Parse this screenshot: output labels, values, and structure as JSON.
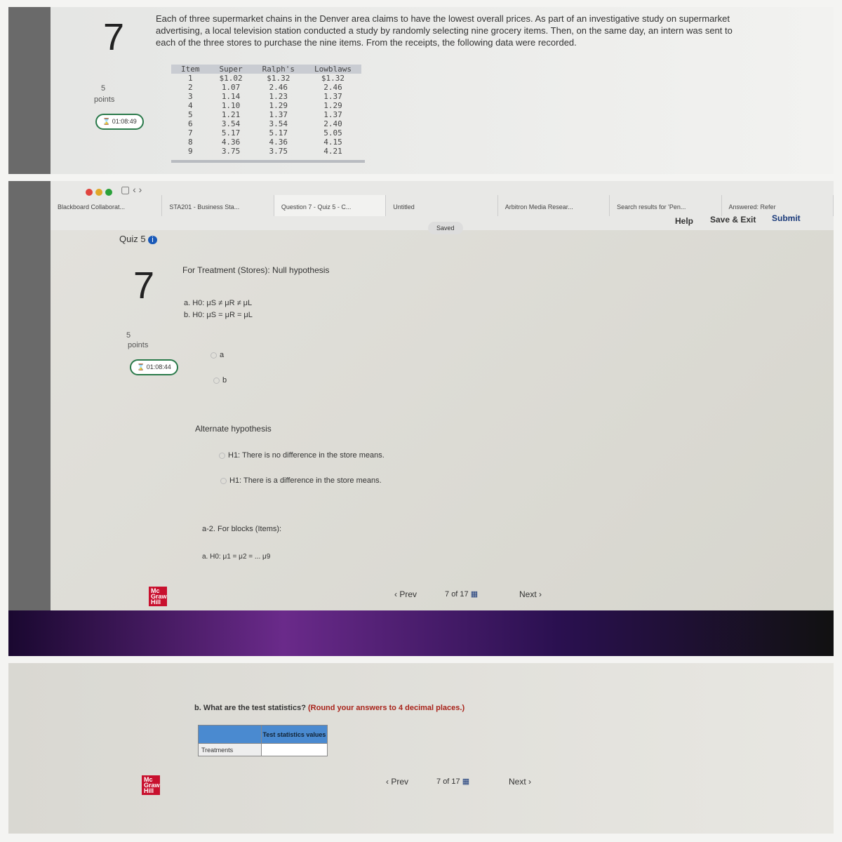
{
  "top": {
    "question_number": "7",
    "points_value": "5",
    "points_label": "points",
    "timer": "01:08:49",
    "intro": "Each of three supermarket chains in the Denver area claims to have the lowest overall prices. As part of an investigative study on supermarket advertising, a local television station conducted a study by randomly selecting nine grocery items. Then, on the same day, an intern was sent to each of the three stores to purchase the nine items. From the receipts, the following data were recorded.",
    "table": {
      "headers": [
        "Item",
        "Super",
        "Ralph's",
        "Lowblaws"
      ],
      "rows": [
        [
          "1",
          "$1.02",
          "$1.32",
          "$1.32"
        ],
        [
          "2",
          "1.07",
          "2.46",
          "2.46"
        ],
        [
          "3",
          "1.14",
          "1.23",
          "1.37"
        ],
        [
          "4",
          "1.10",
          "1.29",
          "1.29"
        ],
        [
          "5",
          "1.21",
          "1.37",
          "1.37"
        ],
        [
          "6",
          "3.54",
          "3.54",
          "2.40"
        ],
        [
          "7",
          "5.17",
          "5.17",
          "5.05"
        ],
        [
          "8",
          "4.36",
          "4.36",
          "4.15"
        ],
        [
          "9",
          "3.75",
          "3.75",
          "4.21"
        ]
      ]
    }
  },
  "browser": {
    "tabs": [
      "Blackboard Collaborat...",
      "STA201 - Business Sta...",
      "Question 7 - Quiz 5 - C...",
      "Untitled",
      "Arbitron Media Resear...",
      "Search results for 'Pen...",
      "Answered: Refer"
    ]
  },
  "quiz": {
    "title": "Quiz 5",
    "saved": "Saved",
    "help": "Help",
    "save_exit": "Save & Exit",
    "submit": "Submit",
    "question_number": "7",
    "points_value": "5",
    "points_label": "points",
    "timer": "01:08:44",
    "null_heading": "For Treatment (Stores): Null hypothesis",
    "null_a": "a. H0: μS ≠ μR ≠ μL",
    "null_b": "b. H0: μS = μR = μL",
    "opt_a": "a",
    "opt_b": "b",
    "alt_heading": "Alternate hypothesis",
    "alt_1": "H1: There is no difference in the store means.",
    "alt_2": "H1: There is a difference in the store means.",
    "blocks_heading": "a-2. For blocks (Items):",
    "blocks_a": "a. H0: μ1 = μ2 = ... μ9",
    "prev": "Prev",
    "page": "7",
    "of": "of 17",
    "next": "Next",
    "logo": "Mc Graw Hill"
  },
  "bottom": {
    "question_b": "b. What are the test statistics?",
    "round_note": "(Round your answers to 4 decimal places.)",
    "col_header": "Test statistics values",
    "row_label": "Treatments",
    "prev": "Prev",
    "page": "7",
    "of": "of 17",
    "next": "Next"
  }
}
